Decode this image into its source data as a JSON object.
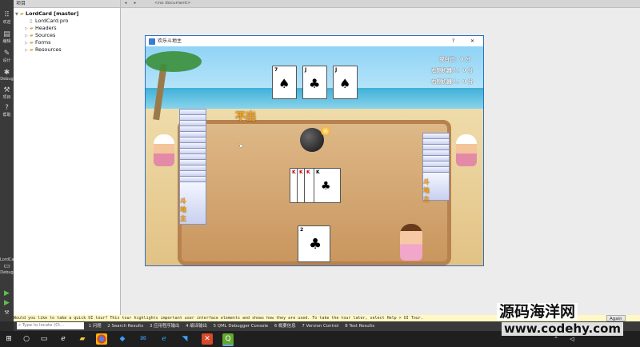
{
  "modes": [
    {
      "label": "欢迎",
      "icon": "grid"
    },
    {
      "label": "编辑",
      "icon": "doc"
    },
    {
      "label": "设计",
      "icon": "pen"
    },
    {
      "label": "Debug",
      "icon": "bug"
    },
    {
      "label": "项目",
      "icon": "wrench"
    },
    {
      "label": "帮助",
      "icon": "help"
    }
  ],
  "kit": {
    "label": "LordCard",
    "debug_label": "Debug"
  },
  "project_panel": {
    "header": "项目",
    "tree": [
      {
        "label": "LordCard [master]",
        "level": 0,
        "bold": true,
        "arrow": "▼"
      },
      {
        "label": "LordCard.pro",
        "level": 1,
        "bold": false,
        "arrow": ""
      },
      {
        "label": "Headers",
        "level": 1,
        "bold": false,
        "arrow": "▷"
      },
      {
        "label": "Sources",
        "level": 1,
        "bold": false,
        "arrow": "▷"
      },
      {
        "label": "Forms",
        "level": 1,
        "bold": false,
        "arrow": "▷"
      },
      {
        "label": "Resources",
        "level": 1,
        "bold": false,
        "arrow": "▷"
      }
    ]
  },
  "editor": {
    "doc_label": "<no document>"
  },
  "game": {
    "title": "欢乐斗地主",
    "help_btn": "?",
    "close_btn": "✕",
    "pass_text": "不出",
    "scores": [
      {
        "label": "我自己：",
        "value": "0 分"
      },
      {
        "label": "左侧机器人：",
        "value": "0 分"
      },
      {
        "label": "右侧机器人：",
        "value": "0 分"
      }
    ],
    "landlord_cards": [
      {
        "rank": "7",
        "suit": "♠"
      },
      {
        "rank": "J",
        "suit": "♣"
      },
      {
        "rank": "J",
        "suit": "♠"
      }
    ],
    "played_cards": [
      {
        "rank": "K",
        "suit": "♥"
      },
      {
        "rank": "K",
        "suit": "♥"
      },
      {
        "rank": "K",
        "suit": "♦"
      },
      {
        "rank": "K",
        "suit": "♣"
      }
    ],
    "player_cards": [
      {
        "rank": "2",
        "suit": "♣"
      }
    ],
    "left_logo": "斗地主",
    "right_logo": "斗地主"
  },
  "tour_bar": {
    "text": "Would you like to take a quick UI tour? This tour highlights important user interface elements and shows how they are used. To take the tour later, select Help > UI Tour.",
    "again_btn": "Again"
  },
  "panes": {
    "locate_placeholder": "Type to locate (Ct...",
    "items": [
      "1 问题",
      "2 Search Results",
      "3 应用程序输出",
      "4 编译输出",
      "5 QML Debugger Console",
      "6 概要信息",
      "7 Version Control",
      "8 Test Results"
    ]
  },
  "watermark": {
    "line1": "源码海洋网",
    "line2": "www.codehy.com"
  }
}
